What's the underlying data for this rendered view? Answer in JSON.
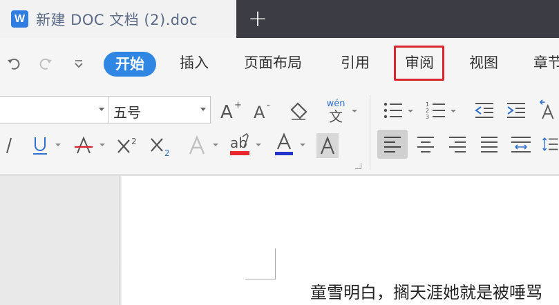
{
  "titlebar": {
    "document_title": "新建 DOC 文档 (2).doc",
    "app_logo_letter": "W",
    "new_tab_label": "+"
  },
  "quick_access": {
    "undo_icon": "undo-icon",
    "redo_icon": "redo-icon",
    "customize_icon": "chevron-down-icon"
  },
  "menu": {
    "items": [
      {
        "label": "开始",
        "active": true
      },
      {
        "label": "插入"
      },
      {
        "label": "页面布局"
      },
      {
        "label": "引用"
      },
      {
        "label": "审阅",
        "highlighted": true
      },
      {
        "label": "视图"
      },
      {
        "label": "章节"
      }
    ]
  },
  "toolbar": {
    "font_name": "",
    "font_size": "五号",
    "phonetic_top": "wén",
    "phonetic_bottom": "文",
    "colors": {
      "highlight": "#e8262b",
      "font_color": "#2233c9",
      "active_tab": "#2f86e3",
      "red_box": "#d9232e"
    }
  },
  "document": {
    "first_line": "童雪明白，搁天涯她就是被唾骂"
  }
}
